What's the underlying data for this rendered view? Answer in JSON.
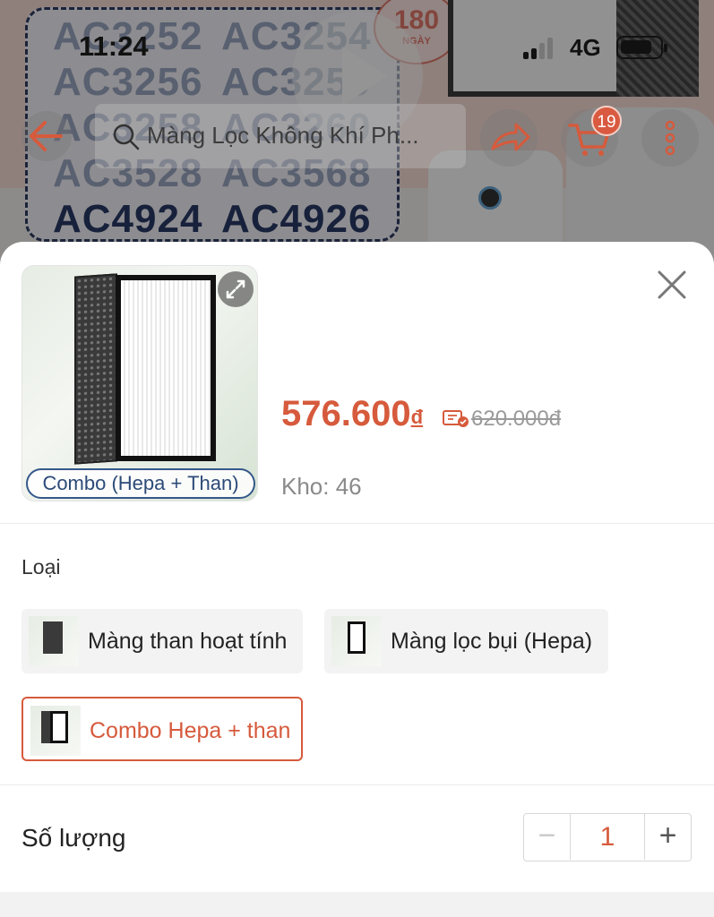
{
  "status_bar": {
    "time": "11:24",
    "network": "4G"
  },
  "banner": {
    "model_codes": [
      [
        "AC3252",
        "AC3254"
      ],
      [
        "AC3256",
        "AC3259"
      ],
      [
        "AC3258",
        "AC3260"
      ],
      [
        "AC3528",
        "AC3568"
      ],
      [
        "AC4924",
        "AC4926"
      ]
    ],
    "warranty_number": "180",
    "warranty_word": "NGÀY"
  },
  "header": {
    "search_text": "Màng Lọc Không Khí Ph...",
    "cart_count": "19"
  },
  "product": {
    "thumbnail_caption": "Combo (Hepa + Than)",
    "price": "576.600",
    "currency_symbol": "đ",
    "original_price": "620.000đ",
    "stock": "Kho: 46"
  },
  "variants": {
    "label": "Loại",
    "items": [
      {
        "label": "Màng than hoạt tính",
        "selected": false
      },
      {
        "label": "Màng lọc bụi (Hepa)",
        "selected": false
      },
      {
        "label": "Combo Hepa + than",
        "selected": true
      }
    ]
  },
  "quantity": {
    "label": "Số lượng",
    "value": "1",
    "minus": "−",
    "plus": "+"
  },
  "colors": {
    "accent": "#d65a3c",
    "badge": "#d95a40"
  }
}
